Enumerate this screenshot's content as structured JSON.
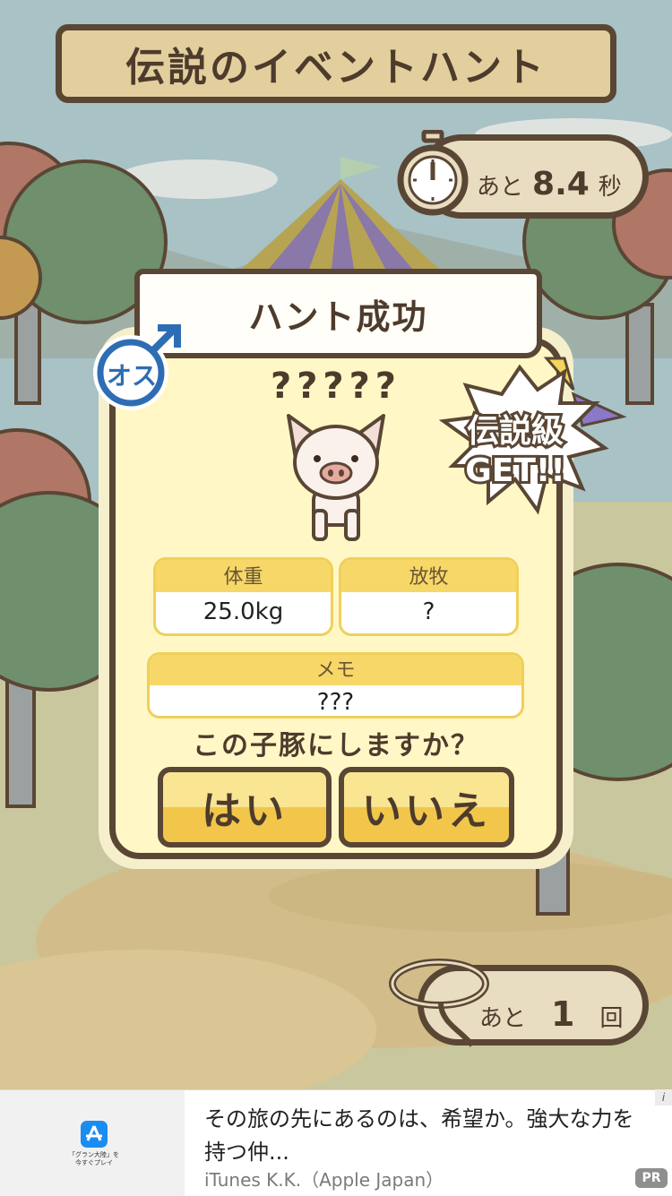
{
  "header": {
    "title": "伝説のイベントハント"
  },
  "timer": {
    "prefix": "あと",
    "value": "8.4",
    "unit": "秒"
  },
  "result": {
    "ribbon_title": "ハント成功",
    "gender_label": "オス",
    "pig_name": "?????",
    "burst_line1": "伝説級",
    "burst_line2": "GET!!",
    "fields": {
      "weight": {
        "label": "体重",
        "value": "25.0kg"
      },
      "grazing": {
        "label": "放牧",
        "value": "?"
      },
      "memo": {
        "label": "メモ",
        "value": "???"
      }
    },
    "question": "この子豚にしますか？",
    "yes_label": "はい",
    "no_label": "いいえ"
  },
  "remaining": {
    "prefix": "あと",
    "value": "1",
    "unit": "回"
  },
  "ad": {
    "title": "その旅の先にあるのは、希望か。強大な力を持つ仲...",
    "advertiser": "iTunes K.K.（Apple Japan）",
    "pr_label": "PR",
    "info_label": "i",
    "app_caption_1": "「グラン大陸」を",
    "app_caption_2": "今すぐプレイ"
  },
  "colors": {
    "outline": "#5a4634",
    "card": "#fff8c6",
    "accent_yellow": "#f2c64a",
    "male_blue": "#2e6db4"
  }
}
